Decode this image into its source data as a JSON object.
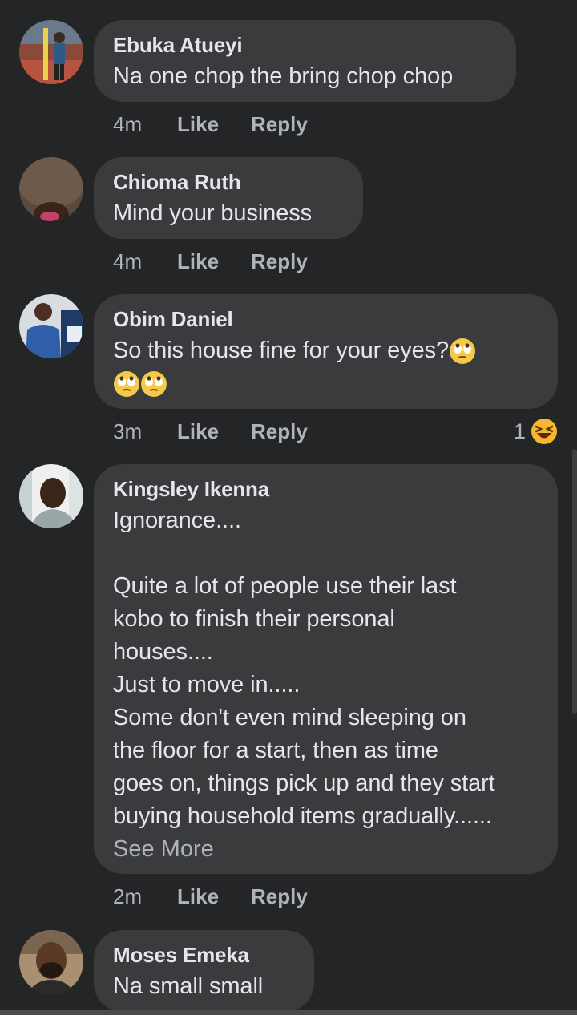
{
  "comments": [
    {
      "author": "Ebuka Atueyi",
      "text": "Na one chop the bring chop chop",
      "time": "4m",
      "like": "Like",
      "reply": "Reply"
    },
    {
      "author": "Chioma Ruth",
      "text": "Mind your business",
      "time": "4m",
      "like": "Like",
      "reply": "Reply"
    },
    {
      "author": "Obim Daniel",
      "text": "So this house fine for your eyes?",
      "emojis": [
        "face-with-rolling-eyes",
        "face-with-rolling-eyes",
        "face-with-rolling-eyes"
      ],
      "time": "3m",
      "like": "Like",
      "reply": "Reply",
      "reaction_count": "1",
      "reaction_icon": "laughing-face-icon"
    },
    {
      "author": "Kingsley Ikenna",
      "text": "Ignorance....\n\nQuite a lot of people use their last\nkobo to finish their personal\nhouses....\nJust to move in.....\nSome don't even mind sleeping on\nthe floor for a start, then as time\ngoes on, things pick up and they start\nbuying household items gradually......",
      "see_more": "See More",
      "time": "2m",
      "like": "Like",
      "reply": "Reply"
    },
    {
      "author": "Moses Emeka",
      "text": "Na small small"
    }
  ],
  "colors": {
    "background": "#242526",
    "bubble": "#3a3b3c",
    "primary_text": "#e4e6eb",
    "secondary_text": "#b0b3b8"
  }
}
